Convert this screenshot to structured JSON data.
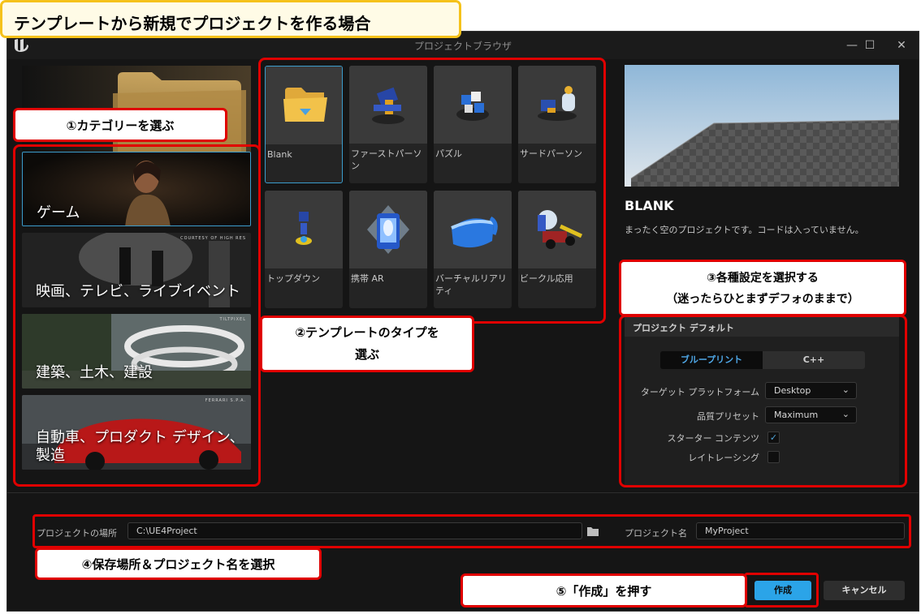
{
  "headline": "テンプレートから新規でプロジェクトを作る場合",
  "window": {
    "title": "プロジェクトブラウザ",
    "controls": {
      "minimize": "—",
      "maximize": "☐",
      "close": "✕"
    }
  },
  "categories": [
    {
      "label": "ゲーム",
      "selected": true
    },
    {
      "label": "映画、テレビ、ライブイベント",
      "credit": "COURTESY OF HIGH RES"
    },
    {
      "label": "建築、土木、建設",
      "credit": "TILTPIXEL"
    },
    {
      "label_line1": "自動車、プロダクト デザイン、",
      "label_line2": "製造",
      "credit": "FERRARI S.P.A."
    }
  ],
  "templates": [
    {
      "label": "Blank",
      "icon": "folder-icon",
      "selected": true
    },
    {
      "label": "ファーストパーソン",
      "icon": "first-person-icon"
    },
    {
      "label": "パズル",
      "icon": "puzzle-icon"
    },
    {
      "label": "サードパーソン",
      "icon": "third-person-icon"
    },
    {
      "label": "トップダウン",
      "icon": "top-down-icon"
    },
    {
      "label": "携帯 AR",
      "icon": "mobile-ar-icon"
    },
    {
      "label": "バーチャルリアリティ",
      "icon": "vr-headset-icon"
    },
    {
      "label": "ビークル応用",
      "icon": "vehicle-icon"
    }
  ],
  "details": {
    "title": "BLANK",
    "description": "まったく空のプロジェクトです。コードは入っていません。"
  },
  "defaults": {
    "header": "プロジェクト デフォルト",
    "tabs": [
      {
        "label": "ブループリント",
        "active": true
      },
      {
        "label": "C++",
        "active": false
      }
    ],
    "target_platform_label": "ターゲット プラットフォーム",
    "target_platform_value": "Desktop",
    "quality_preset_label": "品質プリセット",
    "quality_preset_value": "Maximum",
    "starter_content_label": "スターター コンテンツ",
    "starter_content_checked": true,
    "check_mark": "✓",
    "raytracing_label": "レイトレーシング",
    "raytracing_checked": false,
    "chevron": "⌄"
  },
  "location": {
    "label": "プロジェクトの場所",
    "value": "C:\\UE4Project",
    "name_label": "プロジェクト名",
    "name_value": "MyProject"
  },
  "buttons": {
    "create": "作成",
    "cancel": "キャンセル"
  },
  "annotations": {
    "step1": "①カテゴリーを選ぶ",
    "step2_line1": "②テンプレートのタイプを",
    "step2_line2": "選ぶ",
    "step3_line1": "③各種設定を選択する",
    "step3_line2": "（迷ったらひとまずデフォのままで）",
    "step4": "④保存場所＆プロジェクト名を選択",
    "step5": "⑤「作成」を押す"
  },
  "colors": {
    "accent": "#3b9ccc",
    "create_button": "#2ba4e8",
    "annotation_red": "#e00000",
    "headline_border": "#f5c21b"
  }
}
